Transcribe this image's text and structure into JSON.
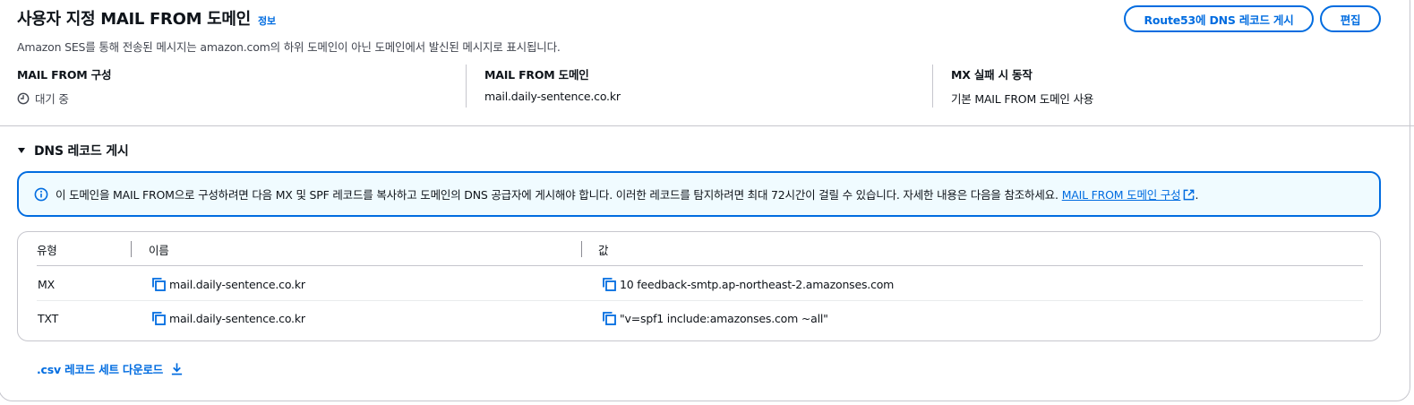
{
  "header": {
    "title": "사용자 지정 MAIL FROM 도메인",
    "info_link": "정보",
    "description": "Amazon SES를 통해 전송된 메시지는 amazon.com의 하위 도메인이 아닌 도메인에서 발신된 메시지로 표시됩니다.",
    "route53_button": "Route53에 DNS 레코드 게시",
    "edit_button": "편집"
  },
  "details": {
    "config_label": "MAIL FROM 구성",
    "config_status": "대기 중",
    "config_status_icon": "clock-icon",
    "domain_label": "MAIL FROM 도메인",
    "domain_value": "mail.daily-sentence.co.kr",
    "mx_failure_label": "MX 실패 시 동작",
    "mx_failure_value": "기본 MAIL FROM 도메인 사용"
  },
  "dns_section": {
    "title": "DNS 레코드 게시",
    "expanded": true,
    "alert_text": "이 도메인을 MAIL FROM으로 구성하려면 다음 MX 및 SPF 레코드를 복사하고 도메인의 DNS 공급자에 게시해야 합니다. 이러한 레코드를 탐지하려면 최대 72시간이 걸릴 수 있습니다. 자세한 내용은 다음을 참조하세요.",
    "alert_link": "MAIL FROM 도메인 구성",
    "alert_suffix": ".",
    "table": {
      "columns": [
        "유형",
        "이름",
        "값"
      ],
      "rows": [
        {
          "type": "MX",
          "name": "mail.daily-sentence.co.kr",
          "value": "10 feedback-smtp.ap-northeast-2.amazonses.com"
        },
        {
          "type": "TXT",
          "name": "mail.daily-sentence.co.kr",
          "value": "\"v=spf1 include:amazonses.com ~all\""
        }
      ]
    },
    "download_label": ".csv 레코드 세트 다운로드"
  },
  "colors": {
    "accent": "#006ce0",
    "alert_bg": "#f0fbff",
    "border": "#c6c6cd",
    "text": "#0f141a",
    "muted_text": "#424650"
  }
}
